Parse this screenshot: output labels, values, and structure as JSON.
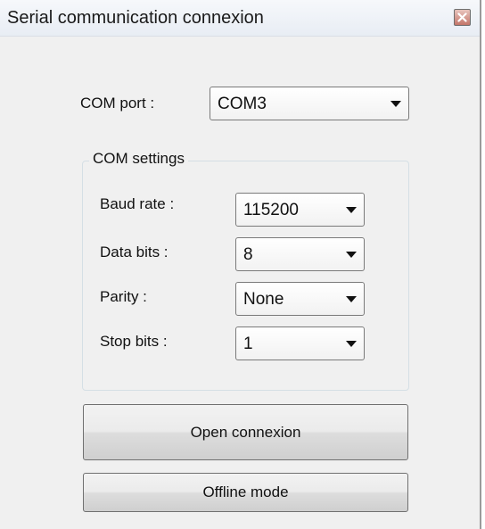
{
  "window": {
    "title": "Serial communication connexion"
  },
  "com_port": {
    "label": "COM port :",
    "value": "COM3"
  },
  "com_settings": {
    "legend": "COM settings",
    "baud_rate": {
      "label": "Baud rate :",
      "value": "115200"
    },
    "data_bits": {
      "label": "Data bits :",
      "value": "8"
    },
    "parity": {
      "label": "Parity :",
      "value": "None"
    },
    "stop_bits": {
      "label": "Stop bits :",
      "value": "1"
    }
  },
  "buttons": {
    "open": "Open connexion",
    "offline": "Offline mode"
  },
  "icons": {
    "close": "close-icon",
    "dropdown": "chevron-down-icon"
  },
  "colors": {
    "window_bg": "#f0f0f0",
    "close_button": "#c4766a"
  }
}
